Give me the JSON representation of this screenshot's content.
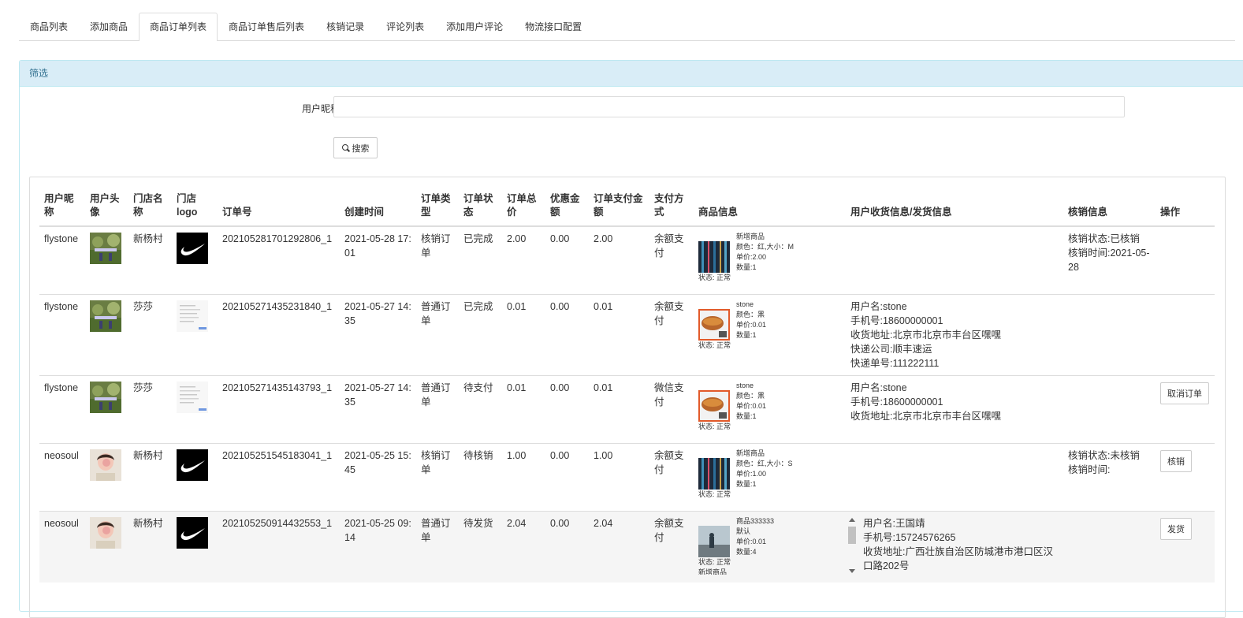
{
  "tabs": [
    "商品列表",
    "添加商品",
    "商品订单列表",
    "商品订单售后列表",
    "核销记录",
    "评论列表",
    "添加用户评论",
    "物流接口配置"
  ],
  "active_tab_index": 2,
  "filter": {
    "panel_title": "筛选",
    "user_nick_label": "用户昵称",
    "user_nick_value": "",
    "search_label": "搜索"
  },
  "table": {
    "headers": {
      "nick": "用户昵称",
      "avatar": "用户头像",
      "store": "门店名称",
      "logo": "门店logo",
      "order_no": "订单号",
      "created": "创建时间",
      "type": "订单类型",
      "status": "订单状态",
      "total": "订单总价",
      "discount": "优惠金额",
      "paid": "订单支付金额",
      "pay_method": "支付方式",
      "goods": "商品信息",
      "shipping": "用户收货信息/发货信息",
      "verify": "核销信息",
      "ops": "操作"
    },
    "rows": [
      {
        "nick": "flystone",
        "store": "新杨村",
        "order_no": "202105281701292806_1",
        "created": "2021-05-28 17:01",
        "type": "核销订单",
        "status": "已完成",
        "total": "2.00",
        "discount": "0.00",
        "paid": "2.00",
        "pay_method": "余额支付",
        "goods": [
          "新增商品",
          "颜色：红,大小：M",
          "单价:2.00",
          "数量:1",
          "状态: 正常"
        ],
        "shipping": [],
        "verify": [
          "核销状态:已核销",
          "核销时间:2021-05-28"
        ],
        "op": ""
      },
      {
        "nick": "flystone",
        "store": "莎莎",
        "order_no": "202105271435231840_1",
        "created": "2021-05-27 14:35",
        "type": "普通订单",
        "status": "已完成",
        "total": "0.01",
        "discount": "0.00",
        "paid": "0.01",
        "pay_method": "余额支付",
        "goods": [
          "stone",
          "颜色：黑",
          "单价:0.01",
          "数量:1",
          "状态: 正常"
        ],
        "shipping": [
          "用户名:stone",
          "手机号:18600000001",
          "收货地址:北京市北京市丰台区嘿嘿",
          "快递公司:顺丰速运",
          "快递单号:111222111"
        ],
        "verify": [],
        "op": ""
      },
      {
        "nick": "flystone",
        "store": "莎莎",
        "order_no": "202105271435143793_1",
        "created": "2021-05-27 14:35",
        "type": "普通订单",
        "status": "待支付",
        "total": "0.01",
        "discount": "0.00",
        "paid": "0.01",
        "pay_method": "微信支付",
        "goods": [
          "stone",
          "颜色：黑",
          "单价:0.01",
          "数量:1",
          "状态: 正常"
        ],
        "shipping": [
          "用户名:stone",
          "手机号:18600000001",
          "收货地址:北京市北京市丰台区嘿嘿"
        ],
        "verify": [],
        "op": "取消订单"
      },
      {
        "nick": "neosoul",
        "store": "新杨村",
        "order_no": "202105251545183041_1",
        "created": "2021-05-25 15:45",
        "type": "核销订单",
        "status": "待核销",
        "total": "1.00",
        "discount": "0.00",
        "paid": "1.00",
        "pay_method": "余额支付",
        "goods": [
          "新增商品",
          "颜色：红,大小：S",
          "单价:1.00",
          "数量:1",
          "状态: 正常"
        ],
        "shipping": [],
        "verify": [
          "核销状态:未核销",
          "核销时间:"
        ],
        "op": "核销"
      },
      {
        "nick": "neosoul",
        "store": "新杨村",
        "order_no": "202105250914432553_1",
        "created": "2021-05-25 09:14",
        "type": "普通订单",
        "status": "待发货",
        "total": "2.04",
        "discount": "0.00",
        "paid": "2.04",
        "pay_method": "余额支付",
        "goods": [
          "商品333333",
          "默认",
          "单价:0.01",
          "数量:4",
          "状态: 正常",
          "新增商品"
        ],
        "shipping": [
          "用户名:王国靖",
          "手机号:15724576265",
          "收货地址:广西壮族自治区防城港市港口区汉口路202号"
        ],
        "verify": [],
        "op": "发货"
      }
    ]
  }
}
